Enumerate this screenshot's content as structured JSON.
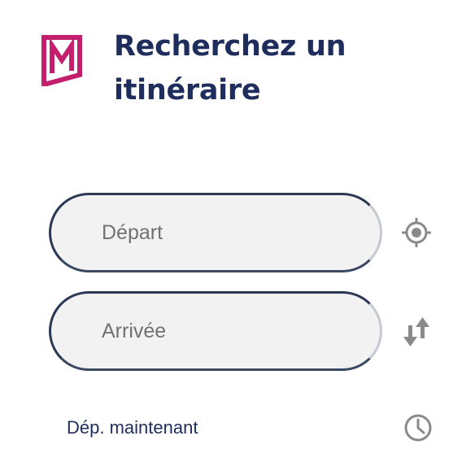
{
  "header": {
    "title": "Recherchez un itinéraire",
    "logo_icon": "brand-logo-icon"
  },
  "form": {
    "departure_placeholder": "Départ",
    "departure_value": "",
    "arrival_placeholder": "Arrivée",
    "arrival_value": "",
    "locate_icon": "locate-me-icon",
    "swap_icon": "swap-arrows-icon",
    "time_label": "Dép. maintenant",
    "clock_icon": "clock-icon"
  },
  "colors": {
    "brand": "#c41f6e",
    "title": "#1e2d5c",
    "field_bg": "#f2f2f3",
    "icon": "#8a8a8a"
  }
}
